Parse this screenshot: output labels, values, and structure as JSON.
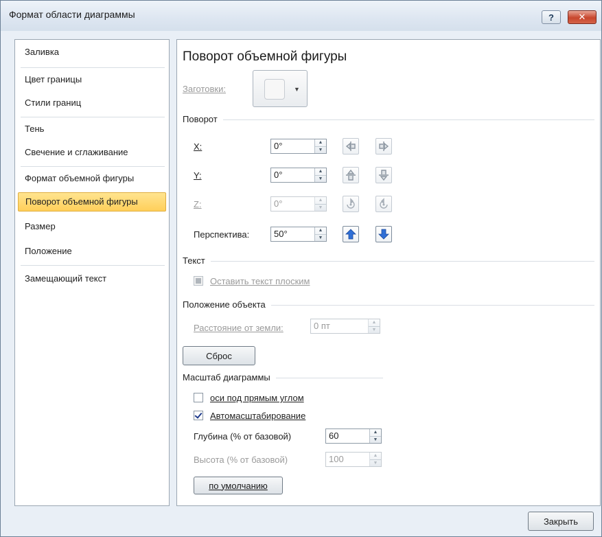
{
  "window": {
    "title": "Формат области диаграммы",
    "help_label": "?",
    "close_label": "✕"
  },
  "nav": {
    "items": [
      {
        "label": "Заливка"
      },
      {
        "label": "Цвет границы"
      },
      {
        "label": "Стили границ"
      },
      {
        "label": "Тень"
      },
      {
        "label": "Свечение и сглаживание"
      },
      {
        "label": "Формат объемной фигуры"
      },
      {
        "label": "Поворот объемной фигуры"
      },
      {
        "label": "Размер"
      },
      {
        "label": "Положение"
      },
      {
        "label": "Замещающий текст"
      }
    ],
    "selected_index": 6
  },
  "panel": {
    "title": "Поворот объемной фигуры",
    "presets_label": "Заготовки:",
    "rotation": {
      "section": "Поворот",
      "x_label": "X:",
      "x_value": "0°",
      "y_label": "Y:",
      "y_value": "0°",
      "z_label": "Z:",
      "z_value": "0°",
      "perspective_label": "Перспектива:",
      "perspective_value": "50°"
    },
    "text": {
      "section": "Текст",
      "keep_flat_label": "Оставить текст плоским"
    },
    "object_position": {
      "section": "Положение объекта",
      "distance_label": "Расстояние от земли:",
      "distance_value": "0 пт"
    },
    "reset_label": "Сброс",
    "chart_scale": {
      "section": "Масштаб диаграммы",
      "right_angle_label": "оси под прямым углом",
      "autoscale_label": "Автомасштабирование",
      "autoscale_checked": true,
      "depth_label": "Глубина (% от базовой)",
      "depth_value": "60",
      "height_label": "Высота (% от базовой)",
      "height_value": "100",
      "default_label": "по умолчанию"
    }
  },
  "footer": {
    "close_label": "Закрыть"
  },
  "colors": {
    "selection": "#ffcf5a",
    "accent_blue": "#2f6fd6",
    "close_red": "#c8462d"
  }
}
